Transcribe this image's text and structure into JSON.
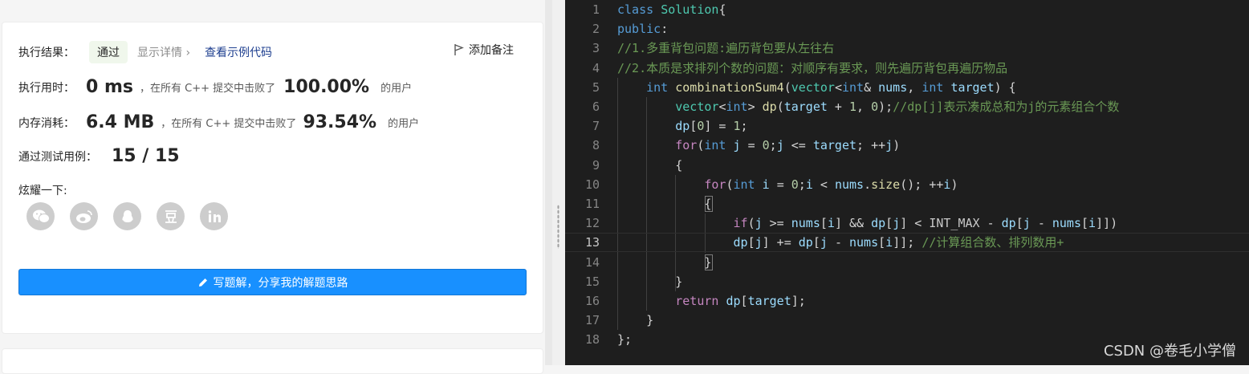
{
  "result": {
    "exec_result_label": "执行结果：",
    "status": "通过",
    "show_detail": "显示详情",
    "view_example": "查看示例代码",
    "add_note": "添加备注"
  },
  "runtime": {
    "label": "执行用时：",
    "value": "0 ms",
    "text": "，在所有 C++ 提交中击败了",
    "percent": "100.00%",
    "suffix": "的用户"
  },
  "memory": {
    "label": "内存消耗：",
    "value": "6.4 MB",
    "text": "，在所有 C++ 提交中击败了",
    "percent": "93.54%",
    "suffix": "的用户"
  },
  "tests": {
    "label": "通过测试用例：",
    "value": "15 / 15"
  },
  "share": {
    "label": "炫耀一下:",
    "icons": [
      "wechat-icon",
      "weibo-icon",
      "qq-icon",
      "douban-icon",
      "linkedin-icon"
    ]
  },
  "write_button": "写题解，分享我的解题思路",
  "editor": {
    "active_line": 13,
    "lines": [
      {
        "n": "1",
        "tokens": [
          [
            "kw",
            "class "
          ],
          [
            "cls",
            "Solution"
          ],
          [
            "",
            "{"
          ]
        ]
      },
      {
        "n": "2",
        "tokens": [
          [
            "kw",
            "public"
          ],
          [
            "",
            ":"
          ]
        ]
      },
      {
        "n": "3",
        "tokens": [
          [
            "cmt",
            "//1.多重背包问题:遍历背包要从左往右"
          ]
        ]
      },
      {
        "n": "4",
        "tokens": [
          [
            "cmt",
            "//2.本质是求排列个数的问题：对顺序有要求，则先遍历背包再遍历物品"
          ]
        ]
      },
      {
        "n": "5",
        "tokens": [
          [
            "",
            "    "
          ],
          [
            "kw",
            "int "
          ],
          [
            "fn",
            "combinationSum4"
          ],
          [
            "",
            "("
          ],
          [
            "cls",
            "vector"
          ],
          [
            "",
            "<"
          ],
          [
            "kw",
            "int"
          ],
          [
            "",
            "& "
          ],
          [
            "var",
            "nums"
          ],
          [
            "",
            ", "
          ],
          [
            "kw",
            "int "
          ],
          [
            "var",
            "target"
          ],
          [
            "",
            ") {"
          ]
        ]
      },
      {
        "n": "6",
        "tokens": [
          [
            "",
            "        "
          ],
          [
            "cls",
            "vector"
          ],
          [
            "",
            "<"
          ],
          [
            "kw",
            "int"
          ],
          [
            "",
            "> "
          ],
          [
            "fn",
            "dp"
          ],
          [
            "",
            "("
          ],
          [
            "var",
            "target"
          ],
          [
            "",
            " + "
          ],
          [
            "num",
            "1"
          ],
          [
            "",
            ", "
          ],
          [
            "num",
            "0"
          ],
          [
            "",
            ");"
          ],
          [
            "cmt",
            "//dp[j]表示凑成总和为j的元素组合个数"
          ]
        ]
      },
      {
        "n": "7",
        "tokens": [
          [
            "",
            "        "
          ],
          [
            "var",
            "dp"
          ],
          [
            "",
            "["
          ],
          [
            "num",
            "0"
          ],
          [
            "",
            "] = "
          ],
          [
            "num",
            "1"
          ],
          [
            "",
            ";"
          ]
        ]
      },
      {
        "n": "8",
        "tokens": [
          [
            "",
            "        "
          ],
          [
            "ctl",
            "for"
          ],
          [
            "",
            "("
          ],
          [
            "kw",
            "int "
          ],
          [
            "var",
            "j"
          ],
          [
            "",
            "",
            " "
          ],
          [
            "",
            "= "
          ],
          [
            "num",
            "0"
          ],
          [
            "",
            ";"
          ],
          [
            "var",
            "j"
          ],
          [
            "",
            "",
            " "
          ],
          [
            "",
            "<= "
          ],
          [
            "var",
            "target"
          ],
          [
            "",
            "; ++"
          ],
          [
            "var",
            "j"
          ],
          [
            "",
            ")"
          ]
        ]
      },
      {
        "n": "9",
        "tokens": [
          [
            "",
            "        {"
          ]
        ]
      },
      {
        "n": "10",
        "tokens": [
          [
            "",
            "            "
          ],
          [
            "ctl",
            "for"
          ],
          [
            "",
            "("
          ],
          [
            "kw",
            "int "
          ],
          [
            "var",
            "i"
          ],
          [
            "",
            "",
            " "
          ],
          [
            "",
            "= "
          ],
          [
            "num",
            "0"
          ],
          [
            "",
            ";"
          ],
          [
            "var",
            "i"
          ],
          [
            "",
            "",
            " "
          ],
          [
            "",
            "< "
          ],
          [
            "var",
            "nums"
          ],
          [
            "",
            "."
          ],
          [
            "fn",
            "size"
          ],
          [
            "",
            "(); ++"
          ],
          [
            "var",
            "i"
          ],
          [
            "",
            ")"
          ]
        ]
      },
      {
        "n": "11",
        "tokens": [
          [
            "",
            "            {"
          ]
        ]
      },
      {
        "n": "12",
        "tokens": [
          [
            "",
            "                "
          ],
          [
            "ctl",
            "if"
          ],
          [
            "",
            "("
          ],
          [
            "var",
            "j"
          ],
          [
            "",
            "",
            " "
          ],
          [
            "",
            ">= "
          ],
          [
            "var",
            "nums"
          ],
          [
            "",
            "["
          ],
          [
            "var",
            "i"
          ],
          [
            "",
            "] && "
          ],
          [
            "var",
            "dp"
          ],
          [
            "",
            "["
          ],
          [
            "var",
            "j"
          ],
          [
            "",
            "] < "
          ],
          [
            "mac",
            "INT_MAX"
          ],
          [
            "",
            "",
            " "
          ],
          [
            "",
            "- "
          ],
          [
            "var",
            "dp"
          ],
          [
            "",
            "["
          ],
          [
            "var",
            "j"
          ],
          [
            "",
            "",
            " "
          ],
          [
            "",
            "- "
          ],
          [
            "var",
            "nums"
          ],
          [
            "",
            "["
          ],
          [
            "var",
            "i"
          ],
          [
            "",
            "]])"
          ]
        ]
      },
      {
        "n": "13",
        "tokens": [
          [
            "",
            "                "
          ],
          [
            "var",
            "dp"
          ],
          [
            "",
            "["
          ],
          [
            "var",
            "j"
          ],
          [
            "",
            "] += "
          ],
          [
            "var",
            "dp"
          ],
          [
            "",
            "["
          ],
          [
            "var",
            "j"
          ],
          [
            "",
            "",
            " "
          ],
          [
            "",
            "- "
          ],
          [
            "var",
            "nums"
          ],
          [
            "",
            "["
          ],
          [
            "var",
            "i"
          ],
          [
            "",
            "]]; "
          ],
          [
            "cmt",
            "//计算组合数、排列数用+"
          ]
        ]
      },
      {
        "n": "14",
        "tokens": [
          [
            "",
            "            }"
          ]
        ]
      },
      {
        "n": "15",
        "tokens": [
          [
            "",
            "        }"
          ]
        ]
      },
      {
        "n": "16",
        "tokens": [
          [
            "",
            "        "
          ],
          [
            "ctl",
            "return "
          ],
          [
            "var",
            "dp"
          ],
          [
            "",
            "["
          ],
          [
            "var",
            "target"
          ],
          [
            "",
            "];"
          ]
        ]
      },
      {
        "n": "17",
        "tokens": [
          [
            "",
            "    }"
          ]
        ]
      },
      {
        "n": "18",
        "tokens": [
          [
            "",
            "};"
          ]
        ]
      }
    ]
  },
  "watermark": "CSDN @卷毛小学僧"
}
